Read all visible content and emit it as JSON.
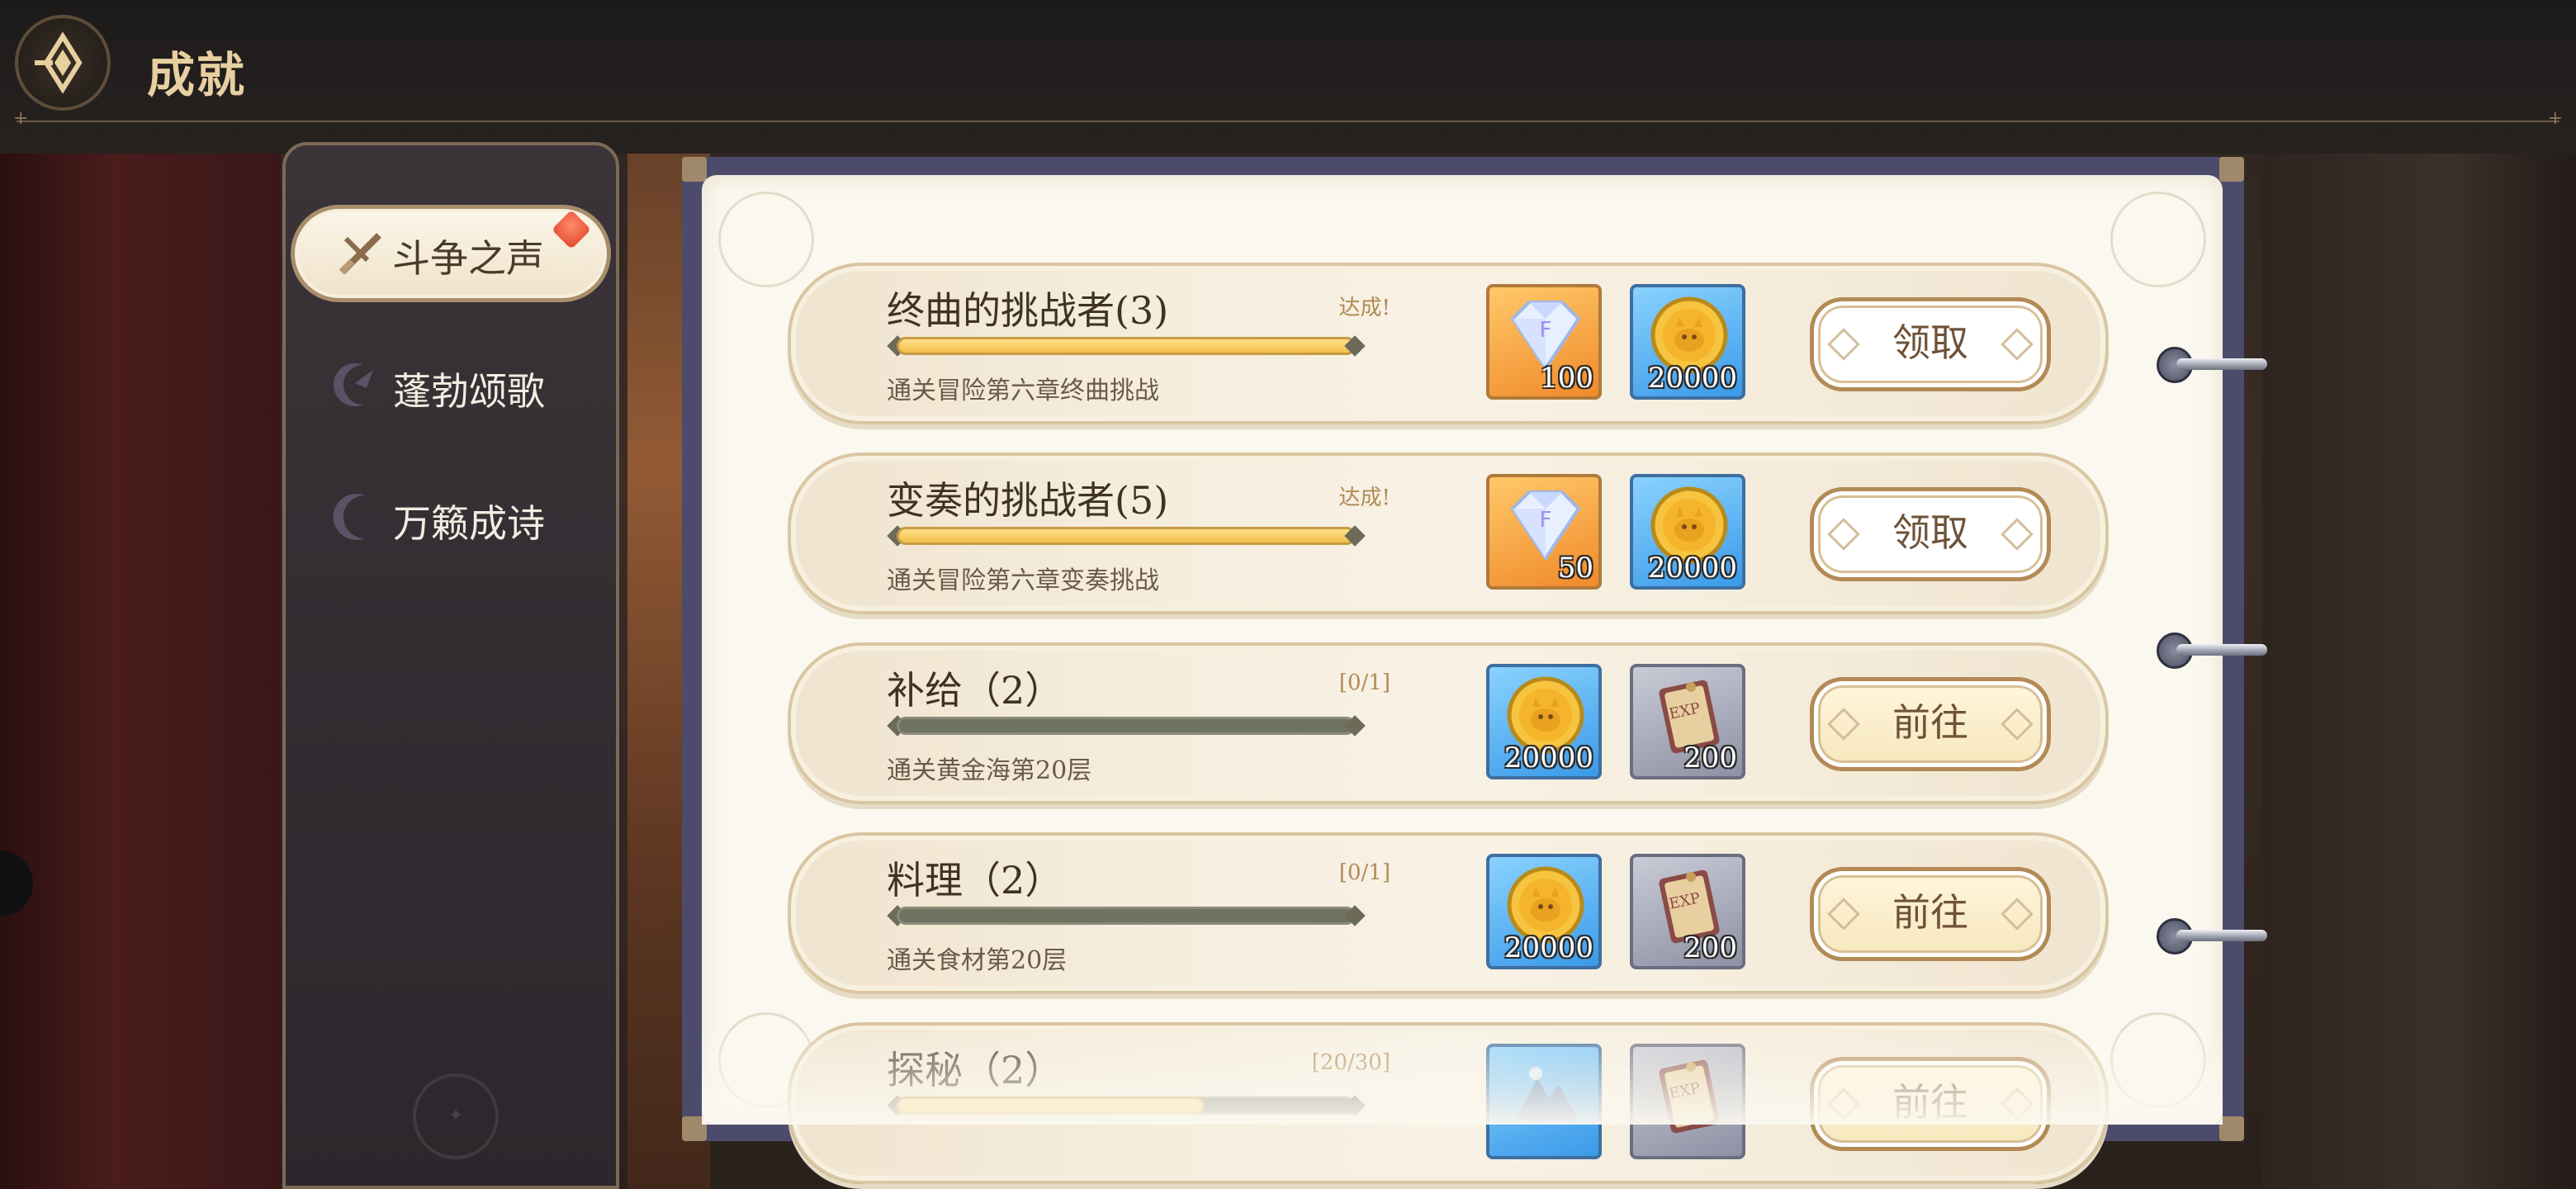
{
  "header": {
    "title": "成就",
    "back_icon": "back-diamond-icon"
  },
  "sidebar": {
    "items": [
      {
        "label": "斗争之声",
        "icon": "swords-icon",
        "active": true,
        "has_badge": true
      },
      {
        "label": "蓬勃颂歌",
        "icon": "crescent-leaf-icon",
        "active": false
      },
      {
        "label": "万籁成诗",
        "icon": "crescent-moon-icon",
        "active": false
      }
    ]
  },
  "achievements": [
    {
      "name": "终曲的挑战者(3)",
      "status": "达成!",
      "progress": 1.0,
      "desc": "通关冒险第六章终曲挑战",
      "rewards": [
        {
          "type": "diamond",
          "qty": "100"
        },
        {
          "type": "gold-coin",
          "qty": "20000"
        }
      ],
      "action": "领取",
      "action_type": "claim"
    },
    {
      "name": "变奏的挑战者(5)",
      "status": "达成!",
      "progress": 1.0,
      "desc": "通关冒险第六章变奏挑战",
      "rewards": [
        {
          "type": "diamond",
          "qty": "50"
        },
        {
          "type": "gold-coin",
          "qty": "20000"
        }
      ],
      "action": "领取",
      "action_type": "claim"
    },
    {
      "name": "补给（2）",
      "status": "[0/1]",
      "progress": 0.0,
      "desc": "通关黄金海第20层",
      "rewards": [
        {
          "type": "gold-coin",
          "qty": "20000"
        },
        {
          "type": "exp-ticket",
          "qty": "200"
        }
      ],
      "action": "前往",
      "action_type": "go"
    },
    {
      "name": "料理（2）",
      "status": "[0/1]",
      "progress": 0.0,
      "desc": "通关食材第20层",
      "rewards": [
        {
          "type": "gold-coin",
          "qty": "20000"
        },
        {
          "type": "exp-ticket",
          "qty": "200"
        }
      ],
      "action": "前往",
      "action_type": "go"
    },
    {
      "name": "探秘（2）",
      "status": "[20/30]",
      "progress": 0.67,
      "desc": "",
      "rewards": [
        {
          "type": "adventure",
          "qty": ""
        },
        {
          "type": "exp-ticket",
          "qty": ""
        }
      ],
      "action": "前往",
      "action_type": "go"
    }
  ],
  "colors": {
    "accent_gold": "#e8cfa0",
    "status_text": "#b08a56",
    "book_frame": "#4d4b6c"
  }
}
